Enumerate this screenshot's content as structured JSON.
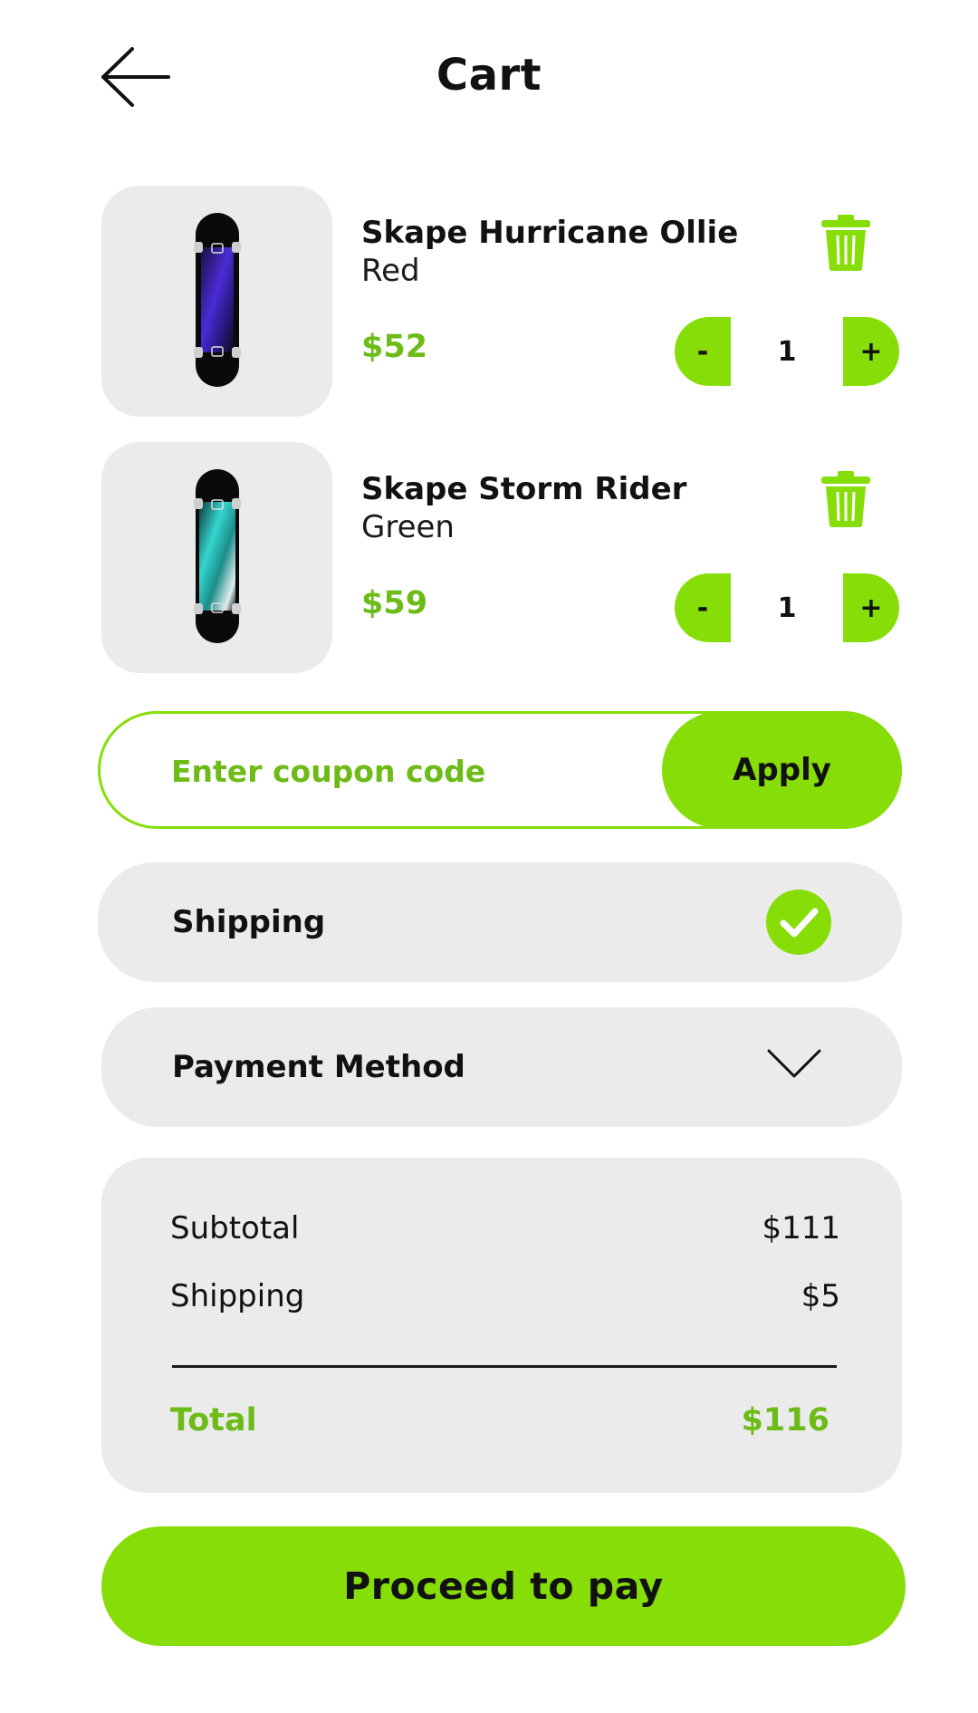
{
  "header": {
    "title": "Cart",
    "back_icon": "arrow-left-icon"
  },
  "cart": {
    "items": [
      {
        "name": "Skape Hurricane Ollie",
        "variant": "Red",
        "price": "$52",
        "quantity": "1",
        "minus_label": "-",
        "plus_label": "+",
        "image": "skateboard-purple-deck",
        "delete_icon": "trash-icon"
      },
      {
        "name": "Skape Storm Rider",
        "variant": "Green",
        "price": "$59",
        "quantity": "1",
        "minus_label": "-",
        "plus_label": "+",
        "image": "skateboard-teal-deck",
        "delete_icon": "trash-icon"
      }
    ]
  },
  "coupon": {
    "placeholder": "Enter coupon code",
    "value": "",
    "apply_label": "Apply"
  },
  "shipping": {
    "label": "Shipping",
    "status_icon": "check-circle-icon"
  },
  "payment": {
    "label": "Payment Method",
    "expand_icon": "chevron-down-icon"
  },
  "summary": {
    "subtotal_label": "Subtotal",
    "subtotal_value": "$111",
    "shipping_label": "Shipping",
    "shipping_value": "$5",
    "total_label": "Total",
    "total_value": "$116"
  },
  "proceed": {
    "label": "Proceed to pay"
  },
  "colors": {
    "accent": "#86dd08",
    "accent_text": "#6cbb16",
    "card_bg": "#ebebeb",
    "text": "#111111"
  }
}
